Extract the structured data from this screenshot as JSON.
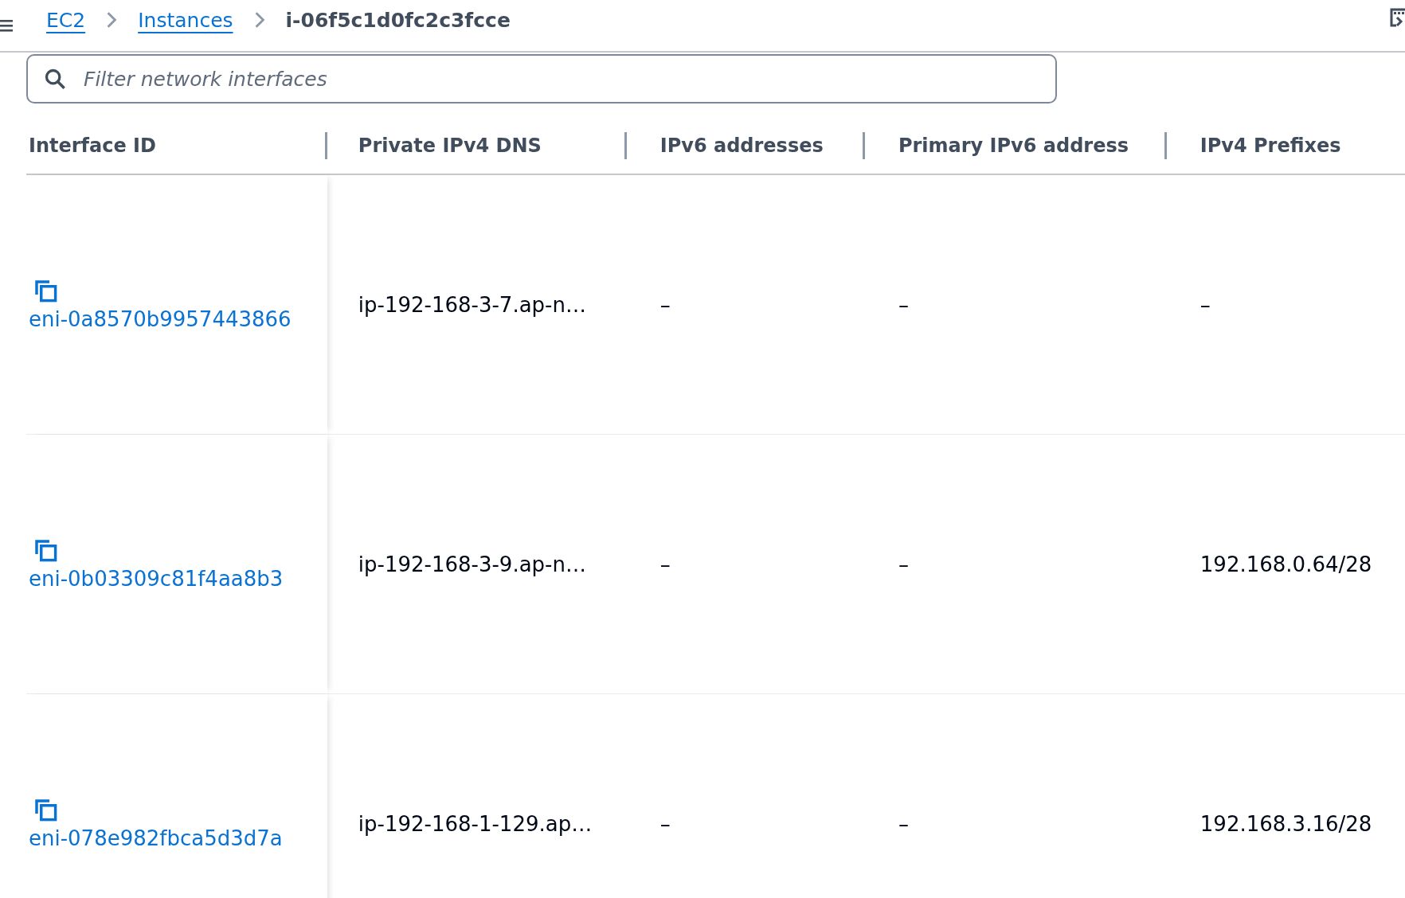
{
  "breadcrumbs": [
    {
      "label": "EC2",
      "link": true
    },
    {
      "label": "Instances",
      "link": true
    },
    {
      "label": "i-06f5c1d0fc2c3fcce",
      "link": false
    }
  ],
  "search": {
    "placeholder": "Filter network interfaces"
  },
  "table": {
    "columns": [
      "Interface ID",
      "Private IPv4 DNS",
      "IPv6 addresses",
      "Primary IPv6 address",
      "IPv4 Prefixes"
    ],
    "rows": [
      {
        "interface_id": "eni-0a8570b9957443866",
        "private_ipv4_dns": "ip-192-168-3-7.ap-n…",
        "ipv6_addresses": "–",
        "primary_ipv6_address": "–",
        "ipv4_prefixes": "–"
      },
      {
        "interface_id": "eni-0b03309c81f4aa8b3",
        "private_ipv4_dns": "ip-192-168-3-9.ap-n…",
        "ipv6_addresses": "–",
        "primary_ipv6_address": "–",
        "ipv4_prefixes": "192.168.0.64/28"
      },
      {
        "interface_id": "eni-078e982fbca5d3d7a",
        "private_ipv4_dns": "ip-192-168-1-129.ap…",
        "ipv6_addresses": "–",
        "primary_ipv6_address": "–",
        "ipv4_prefixes": "192.168.3.16/28"
      }
    ]
  }
}
